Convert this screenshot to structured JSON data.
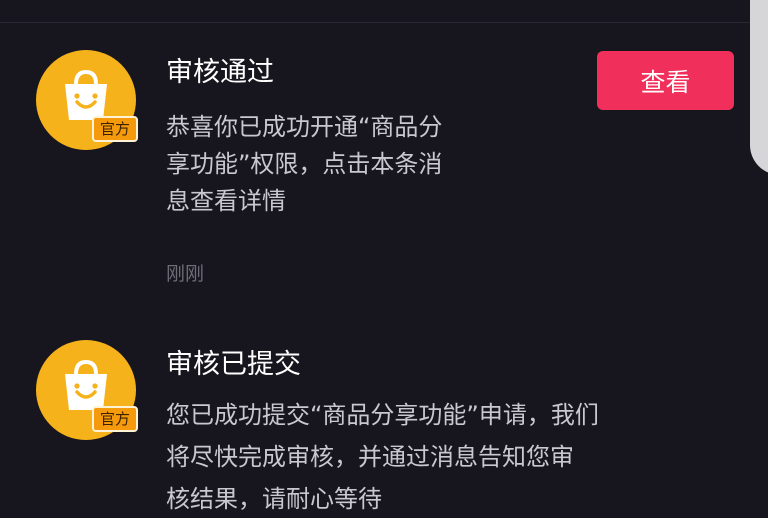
{
  "messages": [
    {
      "title": "审核通过",
      "body_lines": [
        "恭喜你已成功开通“商品分",
        "享功能”权限，点击本条消",
        "息查看详情"
      ],
      "time": "刚刚",
      "badge": "官方",
      "action_label": "查看",
      "avatar_icon": "shopping-bag-smile-icon"
    },
    {
      "title": "审核已提交",
      "body_lines": [
        "您已成功提交“商品分享功能”申请，我们",
        "将尽快完成审核，并通过消息告知您审",
        "核结果，请耐心等待"
      ],
      "badge": "官方",
      "avatar_icon": "shopping-bag-smile-icon"
    }
  ],
  "colors": {
    "background": "#17161f",
    "accent": "#f12f5b",
    "avatar": "#f5b21a"
  }
}
